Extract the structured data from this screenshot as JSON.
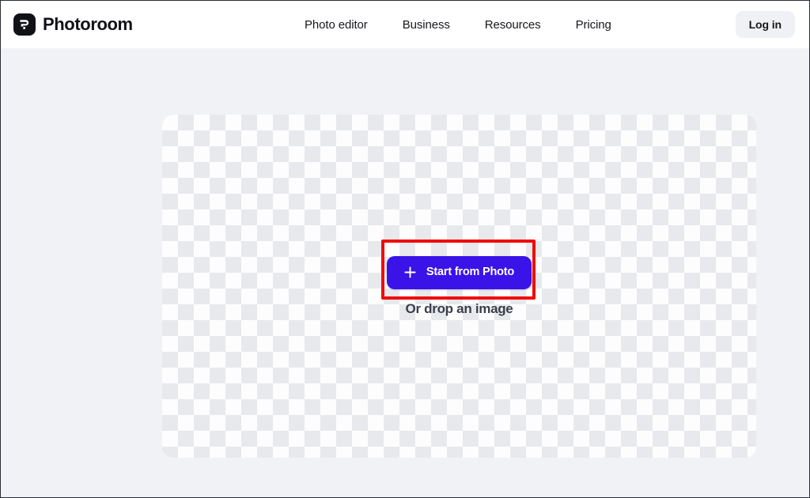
{
  "header": {
    "brand": {
      "name": "Photoroom",
      "icon": "photoroom-logo-icon"
    },
    "nav": [
      {
        "label": "Photo editor"
      },
      {
        "label": "Business"
      },
      {
        "label": "Resources"
      },
      {
        "label": "Pricing"
      }
    ],
    "login_label": "Log in"
  },
  "main": {
    "canvas": {
      "type": "transparent-checkerboard"
    },
    "dropzone": {
      "start_button": {
        "label": "Start from Photo",
        "icon": "plus-icon",
        "color": "#3a13e8",
        "text_color": "#ffffff"
      },
      "drop_hint": "Or drop an image"
    }
  },
  "annotation": {
    "color": "#f10b0b",
    "target": "start-from-photo-button"
  },
  "colors": {
    "page_background": "#f1f2f6",
    "header_background": "#ffffff",
    "accent": "#3a13e8",
    "text_primary": "#16181d",
    "login_chip": "#f0f1f4",
    "checker_light": "#fdfdfe",
    "checker_dark": "#e7e9ec"
  }
}
